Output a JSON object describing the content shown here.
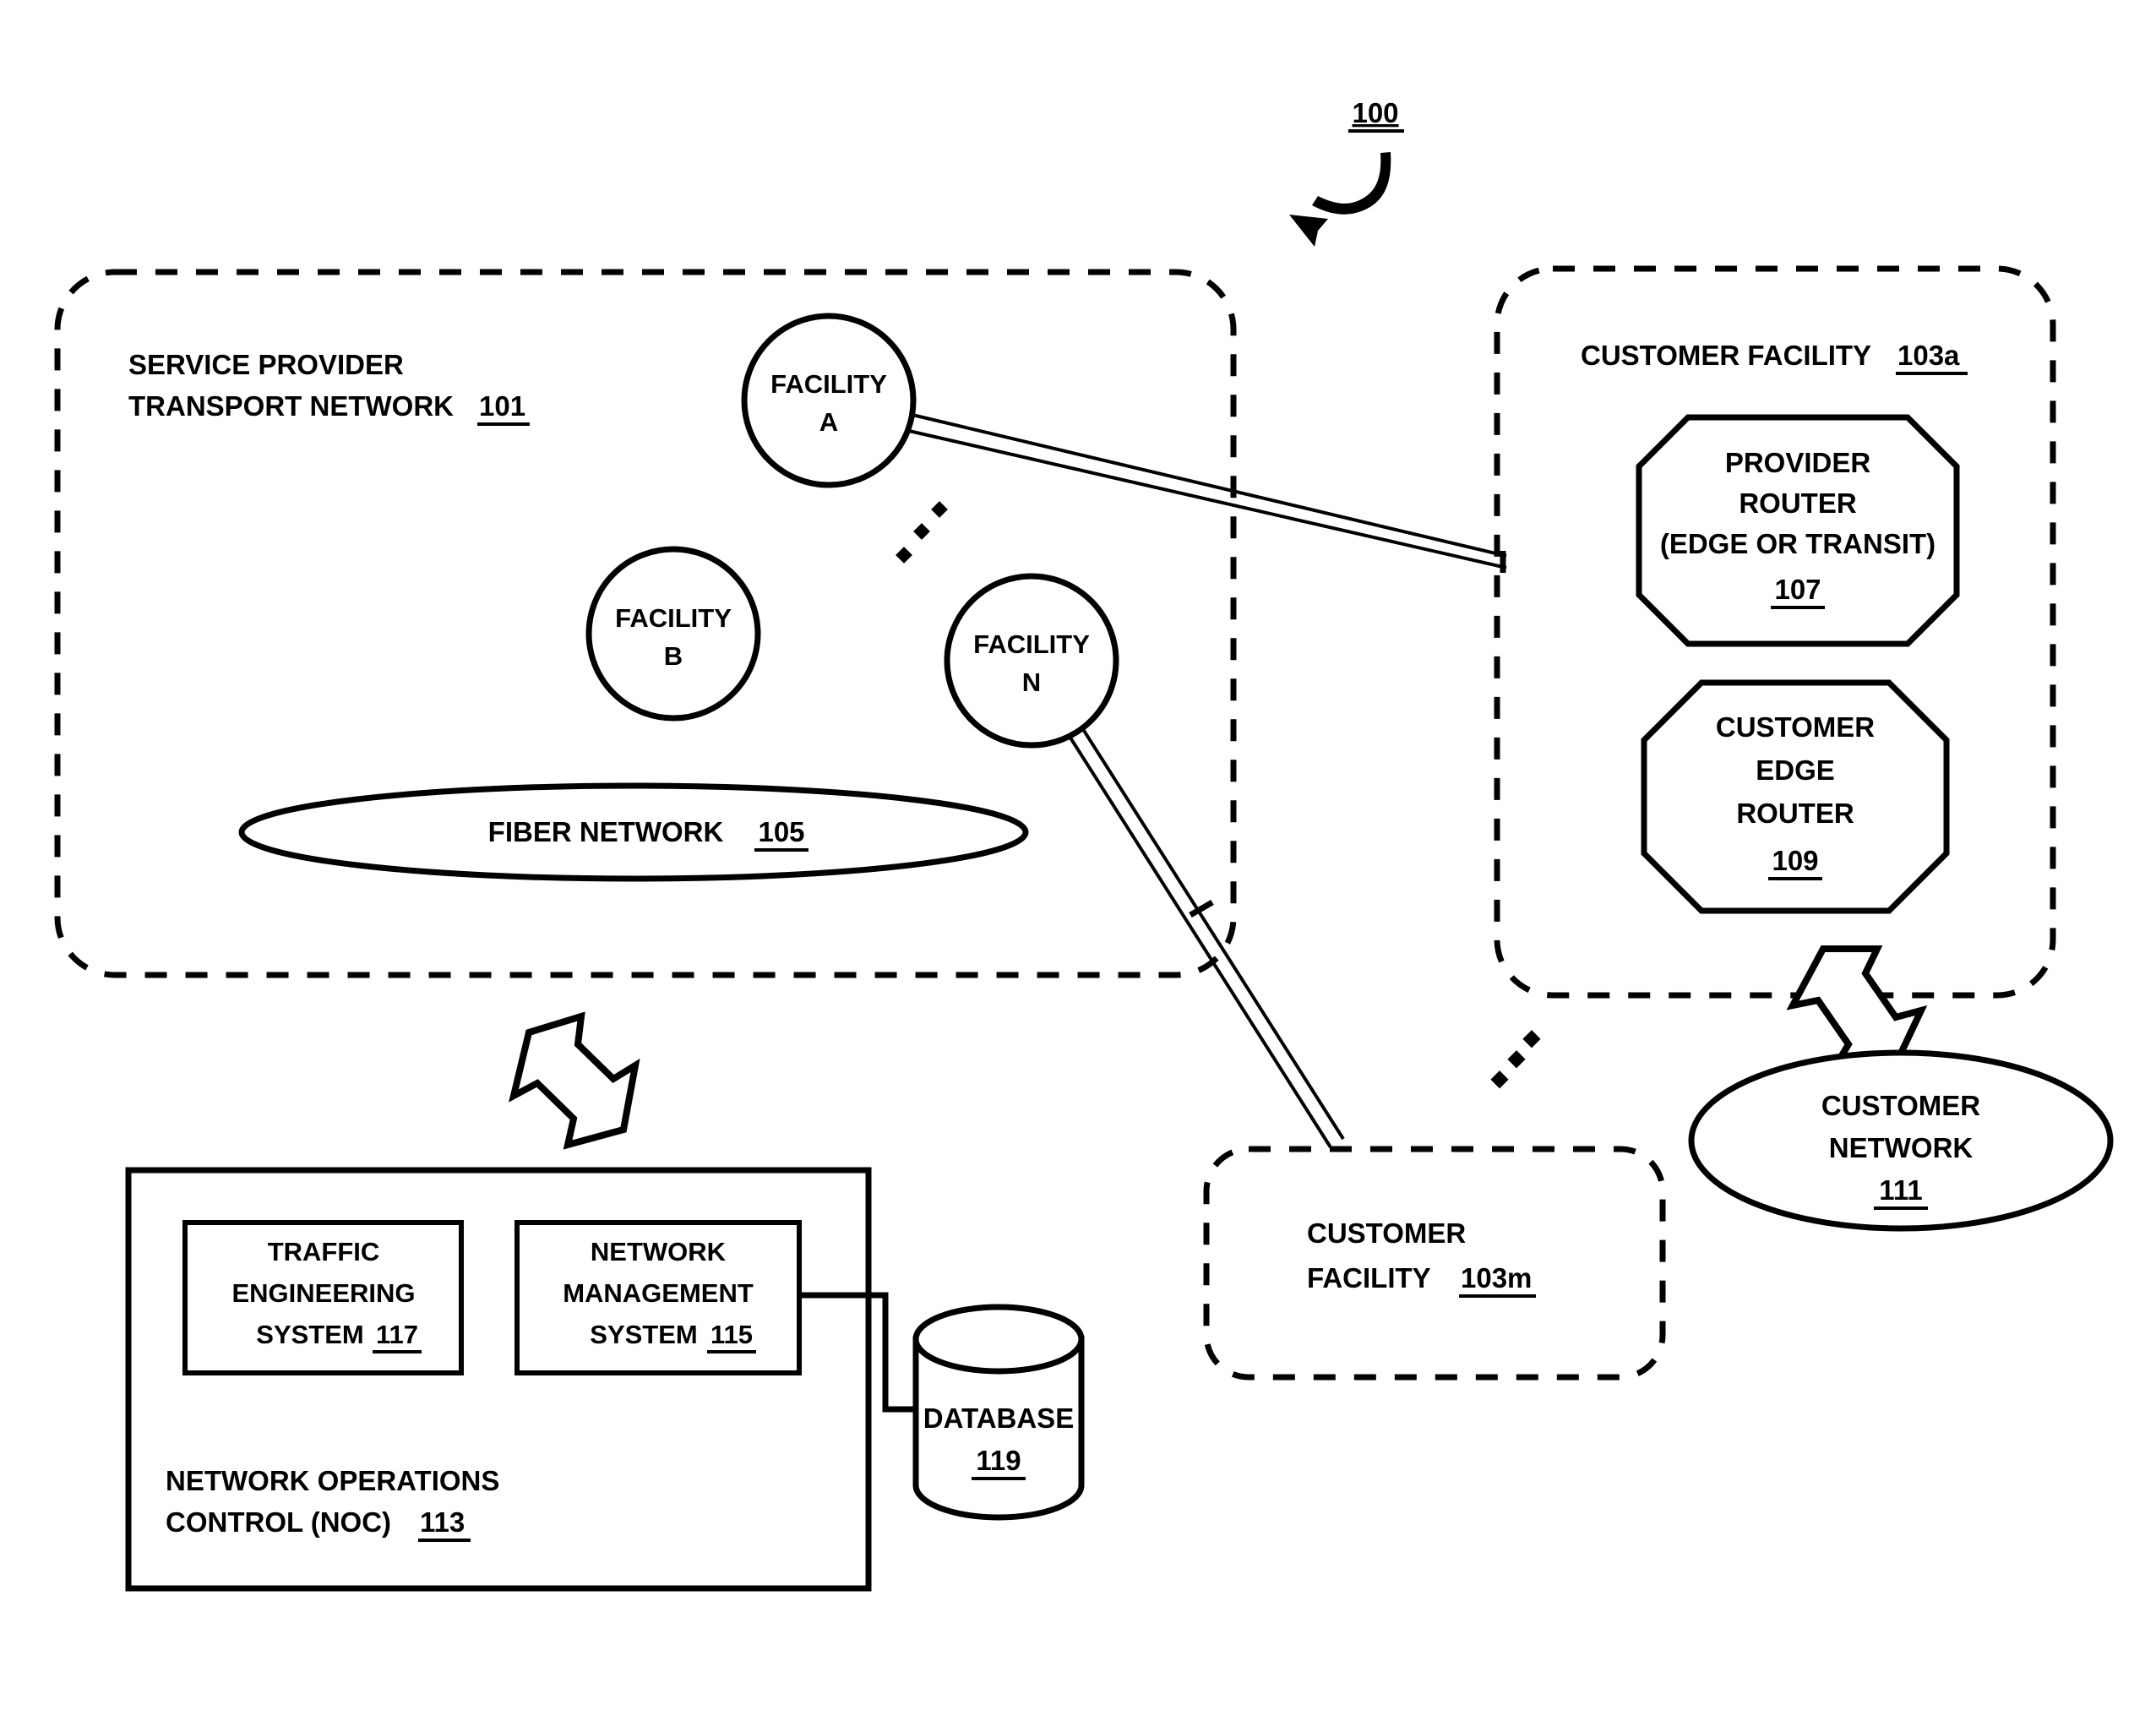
{
  "figure": {
    "number": "100",
    "number_icon": "curved-arrow-icon"
  },
  "regions": {
    "transport_network": {
      "line1": "SERVICE PROVIDER",
      "line2": "TRANSPORT NETWORK",
      "ref": "101"
    },
    "customer_facility_a": {
      "label": "CUSTOMER FACILITY",
      "ref": "103a"
    },
    "customer_facility_m": {
      "line1": "CUSTOMER",
      "line2": "FACILITY",
      "ref": "103m"
    }
  },
  "facilities": [
    {
      "name": "FACILITY",
      "id": "A"
    },
    {
      "name": "FACILITY",
      "id": "B"
    },
    {
      "name": "FACILITY",
      "id": "N"
    }
  ],
  "fiber_network": {
    "label": "FIBER NETWORK",
    "ref": "105"
  },
  "routers": {
    "provider_router": {
      "line1": "PROVIDER",
      "line2": "ROUTER",
      "line3": "(EDGE OR TRANSIT)",
      "ref": "107"
    },
    "customer_edge_router": {
      "line1": "CUSTOMER",
      "line2": "EDGE",
      "line3": "ROUTER",
      "ref": "109"
    }
  },
  "customer_network": {
    "line1": "CUSTOMER",
    "line2": "NETWORK",
    "ref": "111"
  },
  "noc": {
    "line1": "NETWORK OPERATIONS",
    "line2": "CONTROL (NOC)",
    "ref": "113",
    "traffic_engineering_system": {
      "line1": "TRAFFIC",
      "line2": "ENGINEERING",
      "line3": "SYSTEM",
      "ref": "117"
    },
    "network_management_system": {
      "line1": "NETWORK",
      "line2": "MANAGEMENT",
      "line3": "SYSTEM",
      "ref": "115"
    }
  },
  "database": {
    "label": "DATABASE",
    "ref": "119"
  },
  "colors": {
    "stroke": "#000000",
    "fill": "#ffffff"
  }
}
